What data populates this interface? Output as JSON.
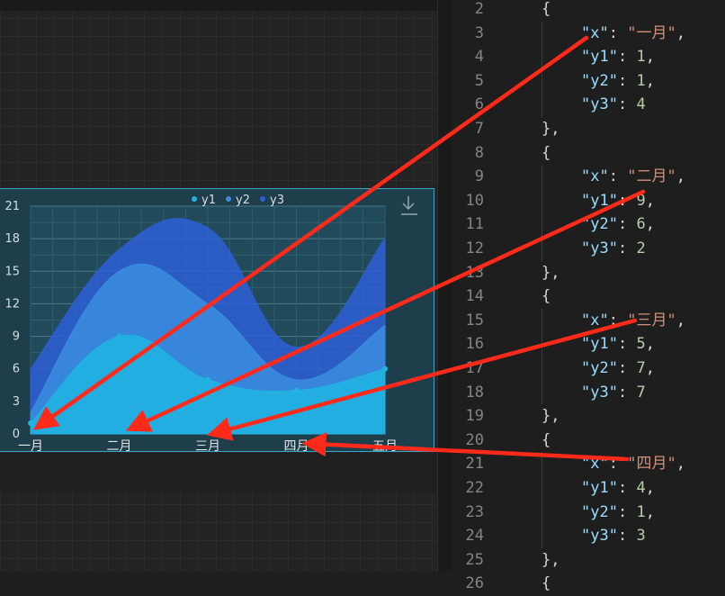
{
  "chart_data": {
    "type": "area",
    "categories": [
      "一月",
      "二月",
      "三月",
      "四月",
      "五月"
    ],
    "series": [
      {
        "name": "y1",
        "values": [
          1,
          9,
          5,
          4,
          6
        ],
        "color": "#1fb5e0"
      },
      {
        "name": "y2",
        "values": [
          1,
          6,
          7,
          1,
          4
        ],
        "color": "#3a8de0"
      },
      {
        "name": "y3",
        "values": [
          4,
          2,
          7,
          3,
          8
        ],
        "color": "#2d5fd6"
      }
    ],
    "stacked": true,
    "ylim": [
      0,
      21
    ],
    "yticks": [
      "0",
      "3",
      "6",
      "9",
      "12",
      "15",
      "18",
      "21"
    ],
    "legend": "top-center",
    "grid": true
  },
  "toolbar": {
    "download_icon": "download-icon"
  },
  "editor": {
    "lines": [
      {
        "num": "2",
        "indent": 1,
        "text": [
          {
            "t": "{",
            "c": "p"
          }
        ]
      },
      {
        "num": "3",
        "indent": 2,
        "text": [
          {
            "t": "\"x\"",
            "c": "k"
          },
          {
            "t": ": ",
            "c": "p"
          },
          {
            "t": "\"一月\"",
            "c": "s"
          },
          {
            "t": ",",
            "c": "p"
          }
        ]
      },
      {
        "num": "4",
        "indent": 2,
        "text": [
          {
            "t": "\"y1\"",
            "c": "k"
          },
          {
            "t": ": ",
            "c": "p"
          },
          {
            "t": "1",
            "c": "n"
          },
          {
            "t": ",",
            "c": "p"
          }
        ]
      },
      {
        "num": "5",
        "indent": 2,
        "text": [
          {
            "t": "\"y2\"",
            "c": "k"
          },
          {
            "t": ": ",
            "c": "p"
          },
          {
            "t": "1",
            "c": "n"
          },
          {
            "t": ",",
            "c": "p"
          }
        ]
      },
      {
        "num": "6",
        "indent": 2,
        "text": [
          {
            "t": "\"y3\"",
            "c": "k"
          },
          {
            "t": ": ",
            "c": "p"
          },
          {
            "t": "4",
            "c": "n"
          }
        ]
      },
      {
        "num": "7",
        "indent": 1,
        "text": [
          {
            "t": "},",
            "c": "p"
          }
        ]
      },
      {
        "num": "8",
        "indent": 1,
        "text": [
          {
            "t": "{",
            "c": "p"
          }
        ]
      },
      {
        "num": "9",
        "indent": 2,
        "text": [
          {
            "t": "\"x\"",
            "c": "k"
          },
          {
            "t": ": ",
            "c": "p"
          },
          {
            "t": "\"二月\"",
            "c": "s"
          },
          {
            "t": ",",
            "c": "p"
          }
        ]
      },
      {
        "num": "10",
        "indent": 2,
        "text": [
          {
            "t": "\"y1\"",
            "c": "k"
          },
          {
            "t": ": ",
            "c": "p"
          },
          {
            "t": "9",
            "c": "n"
          },
          {
            "t": ",",
            "c": "p"
          }
        ]
      },
      {
        "num": "11",
        "indent": 2,
        "text": [
          {
            "t": "\"y2\"",
            "c": "k"
          },
          {
            "t": ": ",
            "c": "p"
          },
          {
            "t": "6",
            "c": "n"
          },
          {
            "t": ",",
            "c": "p"
          }
        ]
      },
      {
        "num": "12",
        "indent": 2,
        "text": [
          {
            "t": "\"y3\"",
            "c": "k"
          },
          {
            "t": ": ",
            "c": "p"
          },
          {
            "t": "2",
            "c": "n"
          }
        ]
      },
      {
        "num": "13",
        "indent": 1,
        "text": [
          {
            "t": "},",
            "c": "p"
          }
        ]
      },
      {
        "num": "14",
        "indent": 1,
        "text": [
          {
            "t": "{",
            "c": "p"
          }
        ]
      },
      {
        "num": "15",
        "indent": 2,
        "text": [
          {
            "t": "\"x\"",
            "c": "k"
          },
          {
            "t": ": ",
            "c": "p"
          },
          {
            "t": "\"三月\"",
            "c": "s"
          },
          {
            "t": ",",
            "c": "p"
          }
        ]
      },
      {
        "num": "16",
        "indent": 2,
        "text": [
          {
            "t": "\"y1\"",
            "c": "k"
          },
          {
            "t": ": ",
            "c": "p"
          },
          {
            "t": "5",
            "c": "n"
          },
          {
            "t": ",",
            "c": "p"
          }
        ]
      },
      {
        "num": "17",
        "indent": 2,
        "text": [
          {
            "t": "\"y2\"",
            "c": "k"
          },
          {
            "t": ": ",
            "c": "p"
          },
          {
            "t": "7",
            "c": "n"
          },
          {
            "t": ",",
            "c": "p"
          }
        ]
      },
      {
        "num": "18",
        "indent": 2,
        "text": [
          {
            "t": "\"y3\"",
            "c": "k"
          },
          {
            "t": ": ",
            "c": "p"
          },
          {
            "t": "7",
            "c": "n"
          }
        ]
      },
      {
        "num": "19",
        "indent": 1,
        "text": [
          {
            "t": "},",
            "c": "p"
          }
        ]
      },
      {
        "num": "20",
        "indent": 1,
        "text": [
          {
            "t": "{",
            "c": "p"
          }
        ]
      },
      {
        "num": "21",
        "indent": 2,
        "text": [
          {
            "t": "\"x\"",
            "c": "k"
          },
          {
            "t": ": ",
            "c": "p"
          },
          {
            "t": "\"四月\"",
            "c": "s"
          },
          {
            "t": ",",
            "c": "p"
          }
        ]
      },
      {
        "num": "22",
        "indent": 2,
        "text": [
          {
            "t": "\"y1\"",
            "c": "k"
          },
          {
            "t": ": ",
            "c": "p"
          },
          {
            "t": "4",
            "c": "n"
          },
          {
            "t": ",",
            "c": "p"
          }
        ]
      },
      {
        "num": "23",
        "indent": 2,
        "text": [
          {
            "t": "\"y2\"",
            "c": "k"
          },
          {
            "t": ": ",
            "c": "p"
          },
          {
            "t": "1",
            "c": "n"
          },
          {
            "t": ",",
            "c": "p"
          }
        ]
      },
      {
        "num": "24",
        "indent": 2,
        "text": [
          {
            "t": "\"y3\"",
            "c": "k"
          },
          {
            "t": ": ",
            "c": "p"
          },
          {
            "t": "3",
            "c": "n"
          }
        ]
      },
      {
        "num": "25",
        "indent": 1,
        "text": [
          {
            "t": "},",
            "c": "p"
          }
        ]
      },
      {
        "num": "26",
        "indent": 1,
        "text": [
          {
            "t": "{",
            "c": "p"
          }
        ]
      }
    ]
  },
  "annotations": {
    "arrow_color": "#ff2a1a",
    "arrows": [
      "一月",
      "二月",
      "三月",
      "四月"
    ]
  }
}
